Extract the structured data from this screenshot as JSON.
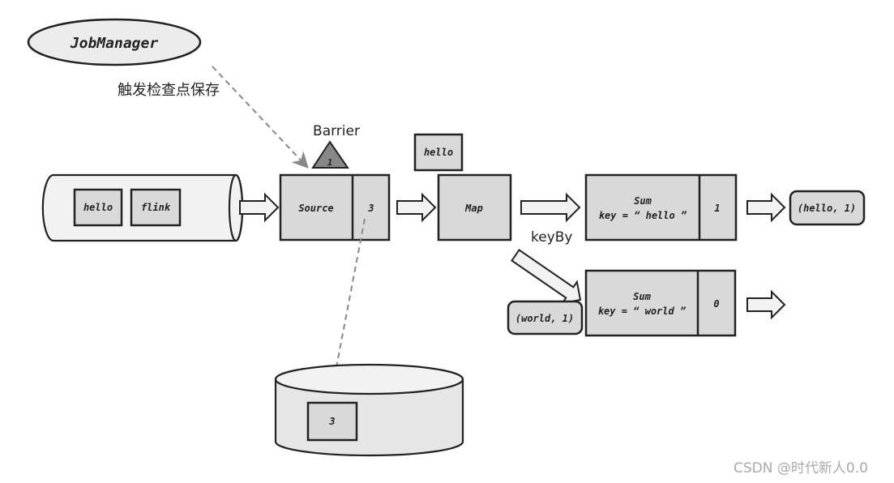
{
  "job_manager": {
    "label": "JobManager"
  },
  "trigger_label": "触发检查点保存",
  "barrier": {
    "label": "Barrier",
    "number": "1"
  },
  "input_stream": {
    "items": [
      "hello",
      "flink"
    ]
  },
  "source": {
    "label": "Source",
    "state": "3"
  },
  "in_flight_record": "hello",
  "map": {
    "label": "Map"
  },
  "keyby_label": "keyBy",
  "sum_hello": {
    "title": "Sum",
    "key": "key = “ hello ”",
    "state": "1",
    "output": "(hello, 1)"
  },
  "sum_world": {
    "title": "Sum",
    "key": "key = “ world ”",
    "state": "0",
    "input": "(world, 1)"
  },
  "checkpoint_store": {
    "state": "3"
  },
  "watermark": "CSDN @时代新人0.0"
}
